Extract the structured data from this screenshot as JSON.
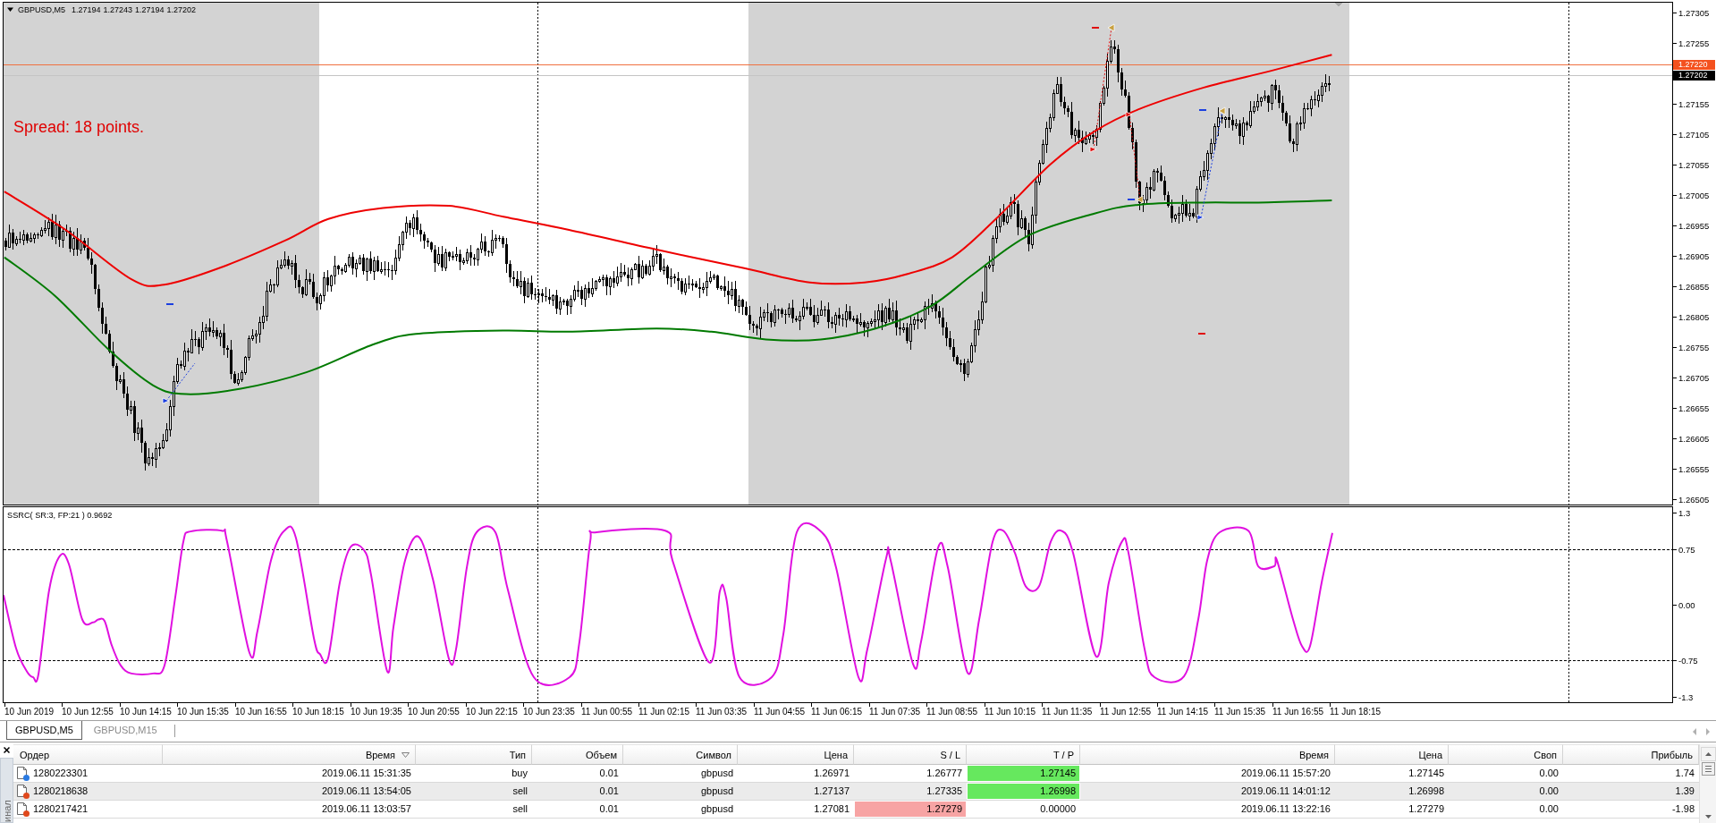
{
  "chart": {
    "symbol": "GBPUSD,M5",
    "ohlc": [
      "1.27194",
      "1.27243",
      "1.27194",
      "1.27202"
    ],
    "spread_label": "Spread: 18 points.",
    "price_axis": [
      "1.27305",
      "1.27255",
      "1.27155",
      "1.27105",
      "1.27055",
      "1.27005",
      "1.26955",
      "1.26905",
      "1.26855",
      "1.26805",
      "1.26755",
      "1.26705",
      "1.26655",
      "1.26605",
      "1.26555",
      "1.26505"
    ],
    "price_tags": [
      {
        "kind": "ask",
        "label": "1.27220"
      },
      {
        "kind": "bid",
        "label": "1.27202"
      }
    ]
  },
  "indicator": {
    "label": "SSRC( SR:3, FP:21 ) 0.9692",
    "axis": [
      "1.3",
      "0.75",
      "0.00",
      "-0.75",
      "-1.3"
    ]
  },
  "time_axis": [
    "10 Jun 2019",
    "10 Jun 12:55",
    "10 Jun 14:15",
    "10 Jun 15:35",
    "10 Jun 16:55",
    "10 Jun 18:15",
    "10 Jun 19:35",
    "10 Jun 20:55",
    "10 Jun 22:15",
    "10 Jun 23:35",
    "11 Jun 00:55",
    "11 Jun 02:15",
    "11 Jun 03:35",
    "11 Jun 04:55",
    "11 Jun 06:15",
    "11 Jun 07:35",
    "11 Jun 08:55",
    "11 Jun 10:15",
    "11 Jun 11:35",
    "11 Jun 12:55",
    "11 Jun 14:15",
    "11 Jun 15:35",
    "11 Jun 16:55",
    "11 Jun 18:15"
  ],
  "chart_tabs": [
    {
      "label": "GBPUSD,M5",
      "selected": true
    },
    {
      "label": "GBPUSD,M15",
      "selected": false
    }
  ],
  "terminal": {
    "side_label": "инал",
    "columns": [
      {
        "label": "Ордер",
        "sorted": false
      },
      {
        "label": "Время",
        "sorted": true
      },
      {
        "label": "Тип",
        "sorted": false
      },
      {
        "label": "Объем",
        "sorted": false
      },
      {
        "label": "Символ",
        "sorted": false
      },
      {
        "label": "Цена",
        "sorted": false
      },
      {
        "label": "S / L",
        "sorted": false
      },
      {
        "label": "T / P",
        "sorted": false
      },
      {
        "label": "Время",
        "sorted": false
      },
      {
        "label": "Цена",
        "sorted": false
      },
      {
        "label": "Своп",
        "sorted": false
      },
      {
        "label": "Прибыль",
        "sorted": false
      }
    ],
    "rows": [
      {
        "color": "#2a7ae2",
        "sl_hit": false,
        "tp_hit": true,
        "cells": [
          "1280223301",
          "2019.06.11 15:31:35",
          "buy",
          "0.01",
          "gbpusd",
          "1.26971",
          "1.26777",
          "1.27145",
          "2019.06.11 15:57:20",
          "1.27145",
          "0.00",
          "1.74"
        ]
      },
      {
        "color": "#e0481c",
        "sl_hit": false,
        "tp_hit": true,
        "cells": [
          "1280218638",
          "2019.06.11 13:54:05",
          "sell",
          "0.01",
          "gbpusd",
          "1.27137",
          "1.27335",
          "1.26998",
          "2019.06.11 14:01:12",
          "1.26998",
          "0.00",
          "1.39"
        ]
      },
      {
        "color": "#e0481c",
        "sl_hit": true,
        "tp_hit": false,
        "cells": [
          "1280217421",
          "2019.06.11 13:03:57",
          "sell",
          "0.01",
          "gbpusd",
          "1.27081",
          "1.27279",
          "0.00000",
          "2019.06.11 13:22:16",
          "1.27279",
          "0.00",
          "-1.98"
        ]
      }
    ]
  }
}
